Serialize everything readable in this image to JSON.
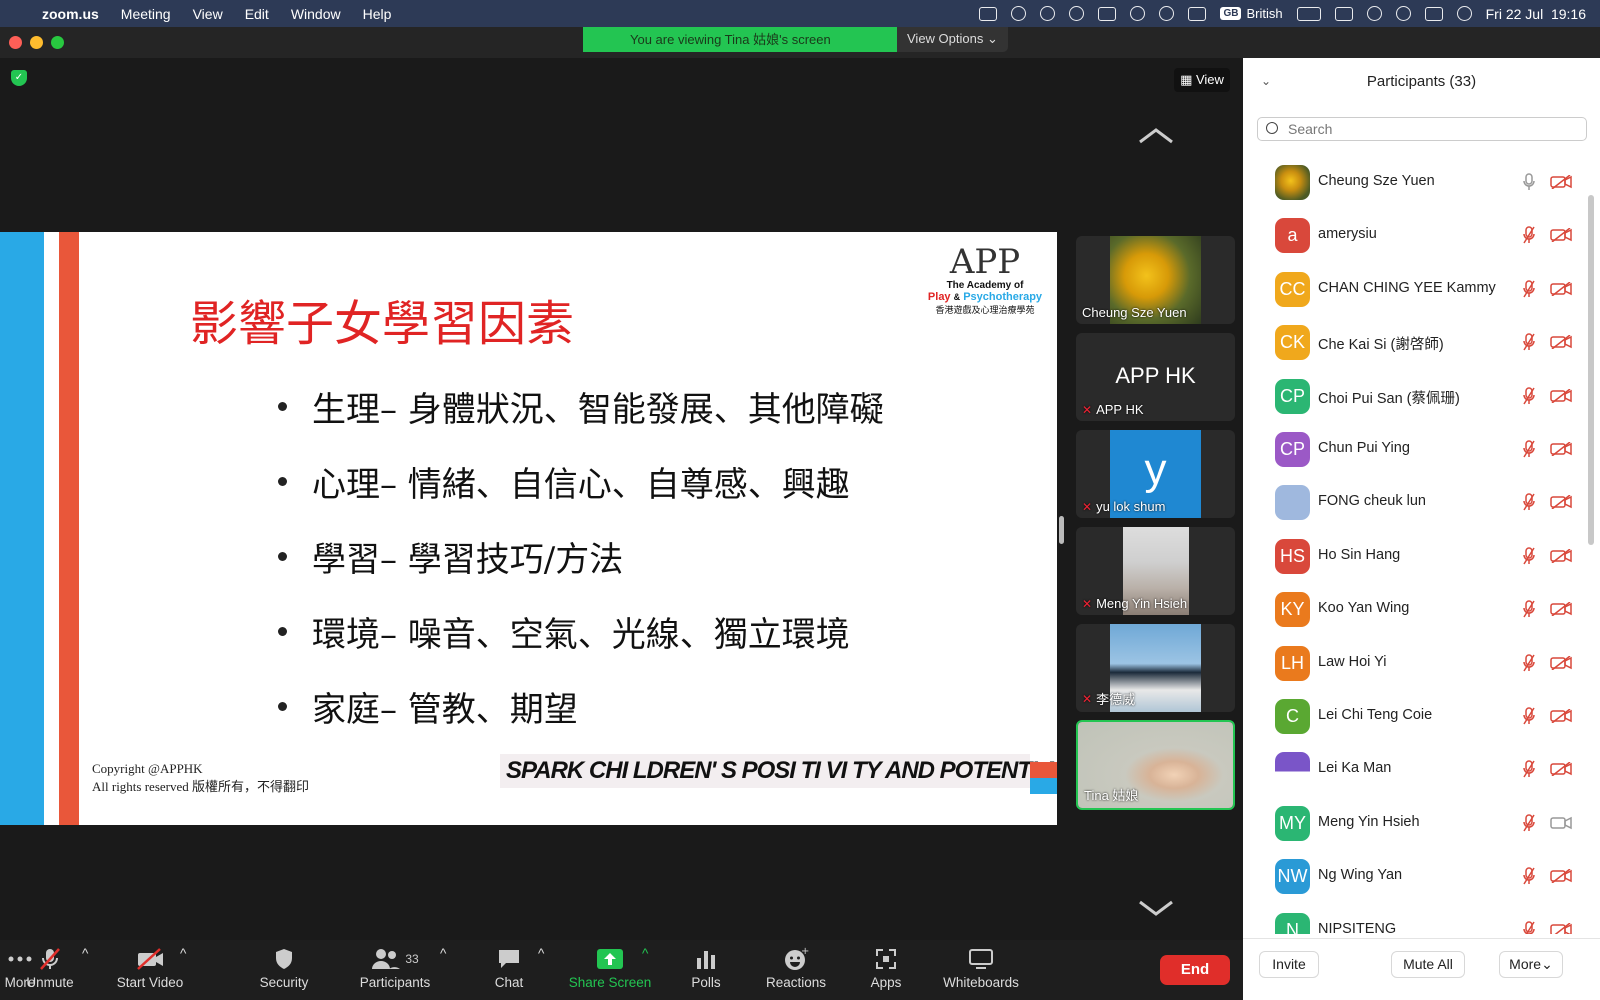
{
  "menubar": {
    "app": "zoom.us",
    "items": [
      "Meeting",
      "View",
      "Edit",
      "Window",
      "Help"
    ],
    "input_source": "British",
    "input_badge": "GB",
    "datetime": "Fri 22 Jul  19:16"
  },
  "banner": {
    "message": "You are viewing Tina 姑娘's screen",
    "view_options": "View Options ⌄"
  },
  "stage": {
    "view_label": "View"
  },
  "slide": {
    "title": "影響子女學習因素",
    "bullets": [
      "生理– 身體狀況、智能發展、其他障礙",
      "心理– 情緒、自信心、自尊感、興趣",
      "學習– 學習技巧/方法",
      "環境– 噪音、空氣、光線、獨立環境",
      "家庭– 管教、期望"
    ],
    "logo": {
      "mark": "APP",
      "line1": "The Academy of",
      "line2a": "Play",
      "line2b": "&",
      "line2c": "Psychotherapy",
      "line3": "香港遊戲及心理治療學苑"
    },
    "copyright_line1": "Copyright @APPHK",
    "copyright_line2": "All rights reserved 版權所有，不得翻印",
    "tagline": "SPARK CHI LDREN' S POSI TI VI TY AND POTENTI AL"
  },
  "strip": [
    {
      "name": "Cheung Sze Yuen",
      "muted": false
    },
    {
      "name": "APP HK",
      "muted": true,
      "big": "APP HK"
    },
    {
      "name": "yu lok shum",
      "muted": true,
      "big": "y"
    },
    {
      "name": "Meng Yin Hsieh",
      "muted": true
    },
    {
      "name": "李德威",
      "muted": true
    },
    {
      "name": "Tina 姑娘",
      "muted": false,
      "active": true
    }
  ],
  "toolbar": {
    "unmute": "Unmute",
    "start_video": "Start Video",
    "security": "Security",
    "participants": "Participants",
    "participants_count": "33",
    "chat": "Chat",
    "share_screen": "Share Screen",
    "polls": "Polls",
    "reactions": "Reactions",
    "apps": "Apps",
    "whiteboards": "Whiteboards",
    "more": "More",
    "end": "End"
  },
  "panel": {
    "title": "Participants (33)",
    "search_placeholder": "Search",
    "participants": [
      {
        "initials": "",
        "name": "Cheung Sze Yuen",
        "color": "#6b7a3a",
        "mic": "on",
        "cam": "off"
      },
      {
        "initials": "a",
        "name": "amerysiu",
        "color": "#d9483b",
        "mic": "off",
        "cam": "off"
      },
      {
        "initials": "CC",
        "name": "CHAN CHING YEE Kammy",
        "color": "#f0a81c",
        "mic": "off",
        "cam": "off"
      },
      {
        "initials": "CK",
        "name": "Che Kai Si (謝啓師)",
        "color": "#f0a81c",
        "mic": "off",
        "cam": "off"
      },
      {
        "initials": "CP",
        "name": "Choi Pui San (蔡佩珊)",
        "color": "#2bb673",
        "mic": "off",
        "cam": "off"
      },
      {
        "initials": "CP",
        "name": "Chun Pui Ying",
        "color": "#9b59c6",
        "mic": "off",
        "cam": "off"
      },
      {
        "initials": "",
        "name": "FONG cheuk lun",
        "color": "#9fb8de",
        "mic": "off",
        "cam": "off"
      },
      {
        "initials": "HS",
        "name": "Ho Sin Hang",
        "color": "#d9483b",
        "mic": "off",
        "cam": "off"
      },
      {
        "initials": "KY",
        "name": "Koo Yan Wing",
        "color": "#ea7a1d",
        "mic": "off",
        "cam": "off"
      },
      {
        "initials": "LH",
        "name": "Law Hoi Yi",
        "color": "#ea7a1d",
        "mic": "off",
        "cam": "off"
      },
      {
        "initials": "C",
        "name": "Lei Chi Teng Coie",
        "color": "#5aa832",
        "mic": "off",
        "cam": "off"
      },
      {
        "initials": "",
        "name": "Lei Ka Man",
        "color": "#7a55c8",
        "mic": "off",
        "cam": "off"
      },
      {
        "initials": "MY",
        "name": "Meng Yin Hsieh",
        "color": "#2bb673",
        "mic": "off",
        "cam": "on"
      },
      {
        "initials": "NW",
        "name": "Ng Wing Yan",
        "color": "#2a9ad6",
        "mic": "off",
        "cam": "off"
      },
      {
        "initials": "N",
        "name": "NIPSITENG",
        "color": "#2bb673",
        "mic": "off",
        "cam": "off"
      }
    ],
    "invite": "Invite",
    "mute_all": "Mute All",
    "more": "More⌄"
  },
  "colors": {
    "accent_green": "#23c552",
    "end_red": "#e02e2a",
    "slide_title_red": "#e02424",
    "slide_blue": "#29a9e6",
    "slide_orange": "#e9573a"
  }
}
